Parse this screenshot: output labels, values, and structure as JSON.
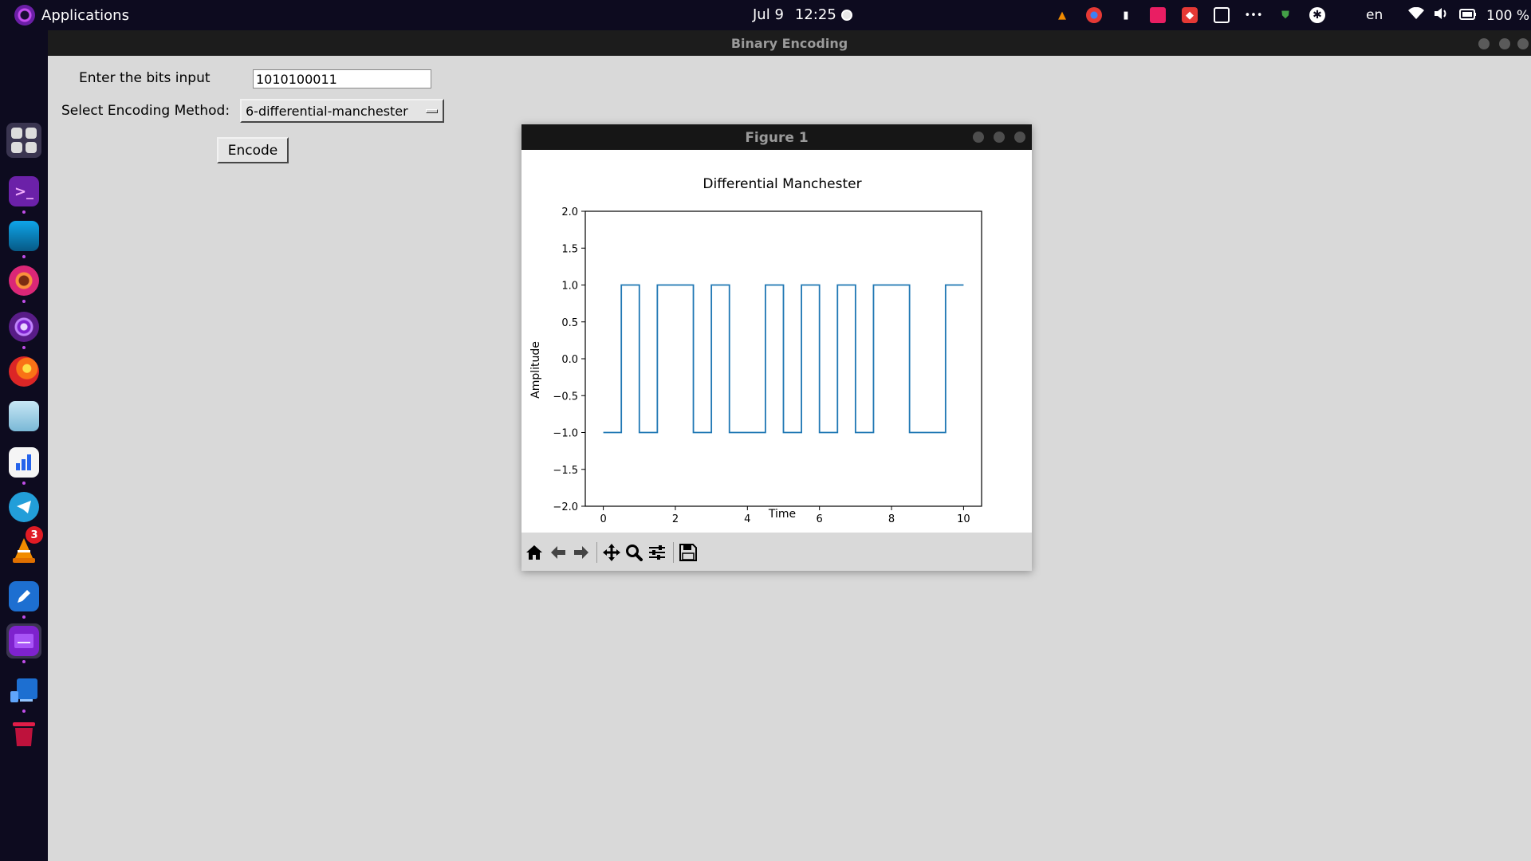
{
  "topbar": {
    "apps_label": "Applications",
    "date": "Jul 9",
    "time": "12:25",
    "language": "en",
    "battery": "100 %"
  },
  "dock": {
    "items": [
      {
        "name": "app-grid",
        "icon": "grid-icon"
      },
      {
        "name": "terminal",
        "icon": "terminal-icon"
      },
      {
        "name": "files",
        "icon": "folder-icon"
      },
      {
        "name": "chrome",
        "icon": "chrome-icon"
      },
      {
        "name": "tor-browser",
        "icon": "tor-icon"
      },
      {
        "name": "firefox",
        "icon": "firefox-icon"
      },
      {
        "name": "anime-app",
        "icon": "avatar-icon"
      },
      {
        "name": "stats-app",
        "icon": "bar-chart-icon"
      },
      {
        "name": "telegram",
        "icon": "telegram-icon"
      },
      {
        "name": "vlc",
        "icon": "vlc-icon"
      },
      {
        "name": "text-editor",
        "icon": "pencil-icon"
      },
      {
        "name": "python-app",
        "icon": "window-icon"
      },
      {
        "name": "remote-desktop",
        "icon": "desktop-icon"
      },
      {
        "name": "trash",
        "icon": "trash-icon"
      }
    ],
    "vlc_badge": "3"
  },
  "main_window": {
    "title": "Binary Encoding",
    "bits_label": "Enter the bits input",
    "bits_value": "1010100011",
    "method_label": "Select Encoding Method:",
    "method_value": "6-differential-manchester",
    "encode_label": "Encode"
  },
  "figure_window": {
    "title": "Figure 1",
    "toolbar": [
      "home-icon",
      "back-icon",
      "forward-icon",
      "pan-icon",
      "zoom-icon",
      "configure-icon",
      "save-icon"
    ]
  },
  "chart_data": {
    "type": "line",
    "title": "Differential Manchester",
    "xlabel": "Time",
    "ylabel": "Amplitude",
    "xlim": [
      -0.5,
      10.5
    ],
    "ylim": [
      -2.0,
      2.0
    ],
    "xticks": [
      0,
      2,
      4,
      6,
      8,
      10
    ],
    "yticks": [
      -2.0,
      -1.5,
      -1.0,
      -0.5,
      0.0,
      0.5,
      1.0,
      1.5,
      2.0
    ],
    "yticklabels": [
      "−2.0",
      "−1.5",
      "−1.0",
      "−0.5",
      "0.0",
      "0.5",
      "1.0",
      "1.5",
      "2.0"
    ],
    "grid": false,
    "series": [
      {
        "color": "#1f77b4",
        "step": true,
        "x": [
          0,
          0.5,
          1,
          1.5,
          2,
          2.5,
          3,
          3.5,
          4,
          4.5,
          5,
          5.5,
          6,
          6.5,
          7,
          7.5,
          8,
          8.5,
          9,
          9.5,
          10
        ],
        "y": [
          -1,
          1,
          -1,
          1,
          1,
          -1,
          1,
          -1,
          -1,
          1,
          -1,
          1,
          -1,
          1,
          -1,
          1,
          1,
          -1,
          -1,
          1,
          1
        ]
      }
    ]
  }
}
